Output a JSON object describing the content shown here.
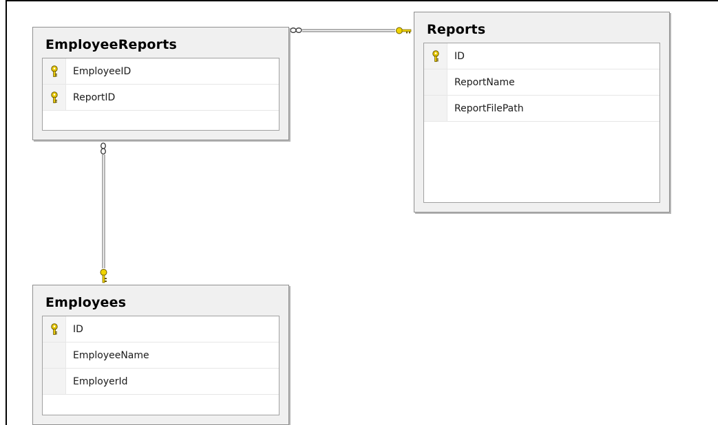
{
  "tables": {
    "employee_reports": {
      "title": "EmployeeReports",
      "columns": [
        {
          "name": "EmployeeID",
          "primary_key": true
        },
        {
          "name": "ReportID",
          "primary_key": true
        }
      ]
    },
    "reports": {
      "title": "Reports",
      "columns": [
        {
          "name": "ID",
          "primary_key": true
        },
        {
          "name": "ReportName",
          "primary_key": false
        },
        {
          "name": "ReportFilePath",
          "primary_key": false
        }
      ]
    },
    "employees": {
      "title": "Employees",
      "columns": [
        {
          "name": "ID",
          "primary_key": true
        },
        {
          "name": "EmployeeName",
          "primary_key": false
        },
        {
          "name": "EmployerId",
          "primary_key": false
        }
      ]
    }
  },
  "relationships": [
    {
      "from": "EmployeeReports",
      "to": "Reports",
      "from_end": "many (infinity)",
      "to_end": "one (key)"
    },
    {
      "from": "EmployeeReports",
      "to": "Employees",
      "from_end": "many (infinity)",
      "to_end": "one (key)"
    }
  ],
  "colors": {
    "key_icon": "#e8c800",
    "key_outline": "#6b5a00",
    "connector": "#808080",
    "table_background": "#f0f0f0"
  },
  "icons": {
    "primary_key": "key-icon",
    "many_end": "infinity-icon",
    "one_end": "key-icon"
  }
}
